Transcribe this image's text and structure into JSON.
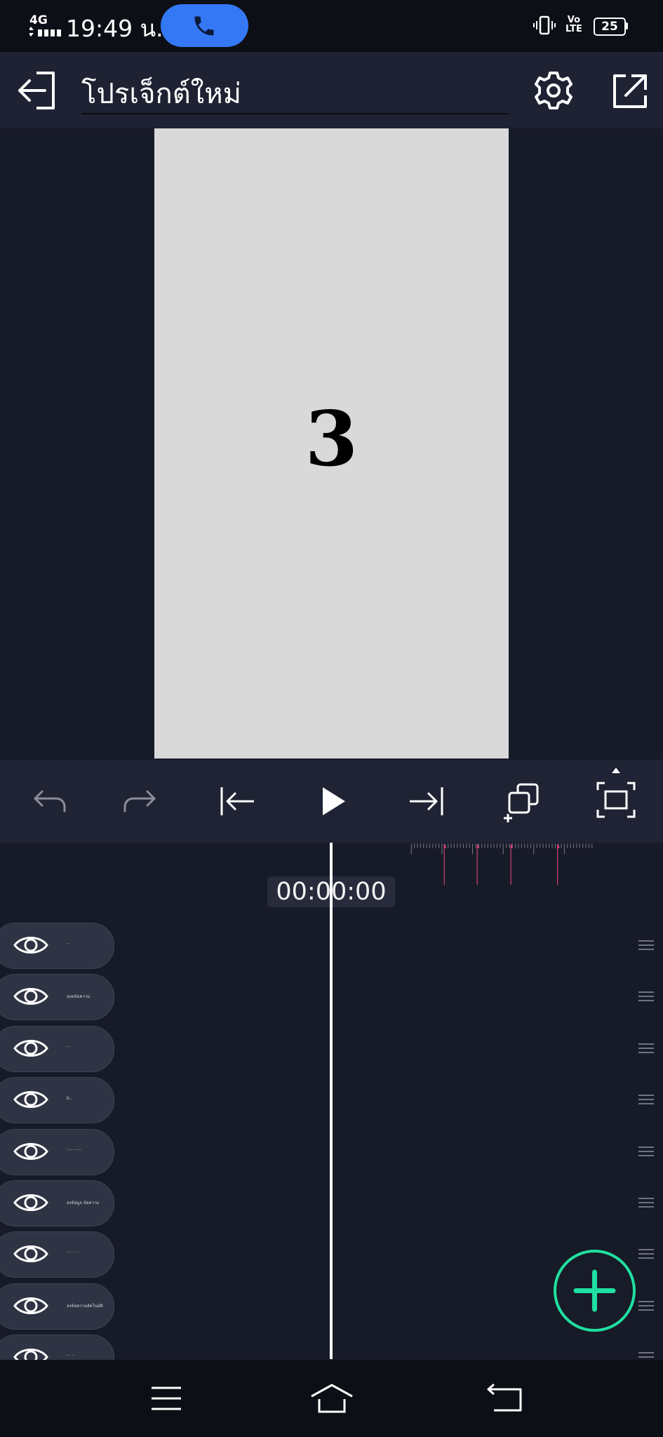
{
  "status_bar": {
    "network": "4G",
    "time": "19:49 น.",
    "call_icon": "phone-icon",
    "volte": "Vo)) LTE",
    "battery": "25"
  },
  "app_bar": {
    "title": "โปรเจ็กต์ใหม่",
    "exit_icon": "exit-icon",
    "settings_icon": "gear-icon",
    "share_icon": "share-icon"
  },
  "preview": {
    "canvas_text": "3",
    "canvas_color": "#d9d9d9"
  },
  "transport": {
    "undo_icon": "undo-icon",
    "redo_icon": "redo-icon",
    "skip_start_icon": "skip-to-start-icon",
    "play_icon": "play-icon",
    "skip_end_icon": "skip-to-end-icon",
    "duplicate_icon": "duplicate-add-icon",
    "fullscreen_icon": "fullscreen-icon"
  },
  "timeline": {
    "timecode": "00:00:00",
    "tracks": [
      {
        "name": "··"
      },
      {
        "name": "ลอยข้อความ"
      },
      {
        "name": "···"
      },
      {
        "name": "b.."
      },
      {
        "name": "····· ·····"
      },
      {
        "name": "ลงข้อมูล ข้อความ"
      },
      {
        "name": "·· ·· · ·"
      },
      {
        "name": "ลงข้อความอัตโนมัติ"
      },
      {
        "name": "··· ··"
      }
    ],
    "marker_color": "#e0457b"
  },
  "fab": {
    "icon": "plus-icon",
    "accent": "#1fe0a0"
  },
  "nav_bar": {
    "menu_icon": "menu-icon",
    "home_icon": "home-icon",
    "back_icon": "back-icon"
  }
}
